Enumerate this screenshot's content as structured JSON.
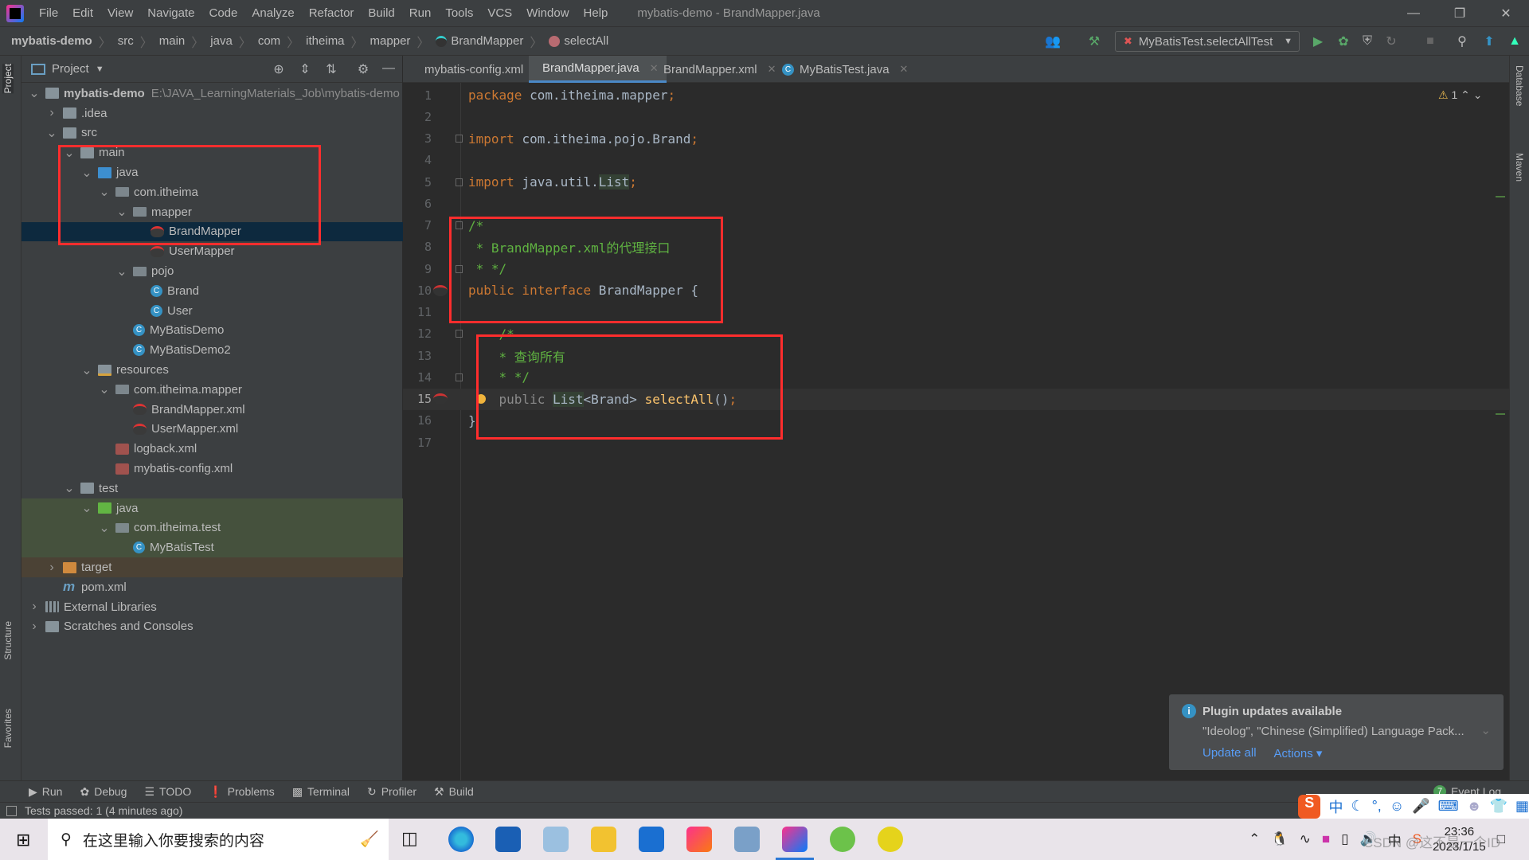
{
  "window": {
    "title": "mybatis-demo - BrandMapper.java",
    "controls": [
      "minimize",
      "restore",
      "close"
    ]
  },
  "menu": [
    "File",
    "Edit",
    "View",
    "Navigate",
    "Code",
    "Analyze",
    "Refactor",
    "Build",
    "Run",
    "Tools",
    "VCS",
    "Window",
    "Help"
  ],
  "breadcrumb": [
    "mybatis-demo",
    "src",
    "main",
    "java",
    "com",
    "itheima",
    "mapper",
    "BrandMapper",
    "selectAll"
  ],
  "toolbar": {
    "run_config": "MyBatisTest.selectAllTest"
  },
  "left_stripe": [
    "Project",
    "Structure",
    "Favorites"
  ],
  "right_stripe": [
    "Database",
    "Maven"
  ],
  "project": {
    "title": "Project",
    "root_path": "E:\\JAVA_LearningMaterials_Job\\mybatis-demo",
    "tree": [
      {
        "label": "mybatis-demo",
        "level": 0,
        "chev": "open",
        "icon": "module",
        "bold": true
      },
      {
        "label": ".idea",
        "level": 1,
        "chev": "closed",
        "icon": "folder"
      },
      {
        "label": "src",
        "level": 1,
        "chev": "open",
        "icon": "folder"
      },
      {
        "label": "main",
        "level": 2,
        "chev": "open",
        "icon": "folder"
      },
      {
        "label": "java",
        "level": 3,
        "chev": "open",
        "icon": "folder-blue"
      },
      {
        "label": "com.itheima",
        "level": 4,
        "chev": "open",
        "icon": "package"
      },
      {
        "label": "mapper",
        "level": 5,
        "chev": "open",
        "icon": "package"
      },
      {
        "label": "BrandMapper",
        "level": 6,
        "icon": "mapper",
        "selected": true
      },
      {
        "label": "UserMapper",
        "level": 6,
        "icon": "mapper"
      },
      {
        "label": "pojo",
        "level": 5,
        "chev": "open",
        "icon": "package"
      },
      {
        "label": "Brand",
        "level": 6,
        "icon": "class"
      },
      {
        "label": "User",
        "level": 6,
        "icon": "class"
      },
      {
        "label": "MyBatisDemo",
        "level": 5,
        "icon": "class"
      },
      {
        "label": "MyBatisDemo2",
        "level": 5,
        "icon": "class"
      },
      {
        "label": "resources",
        "level": 3,
        "chev": "open",
        "icon": "folder-res"
      },
      {
        "label": "com.itheima.mapper",
        "level": 4,
        "chev": "open",
        "icon": "package"
      },
      {
        "label": "BrandMapper.xml",
        "level": 5,
        "icon": "mapper-xml"
      },
      {
        "label": "UserMapper.xml",
        "level": 5,
        "icon": "mapper-xml"
      },
      {
        "label": "logback.xml",
        "level": 4,
        "icon": "xml"
      },
      {
        "label": "mybatis-config.xml",
        "level": 4,
        "icon": "xml"
      },
      {
        "label": "test",
        "level": 2,
        "chev": "open",
        "icon": "folder"
      },
      {
        "label": "java",
        "level": 3,
        "chev": "open",
        "icon": "folder-green",
        "test": true
      },
      {
        "label": "com.itheima.test",
        "level": 4,
        "chev": "open",
        "icon": "package",
        "test": true
      },
      {
        "label": "MyBatisTest",
        "level": 5,
        "icon": "class",
        "test": true
      },
      {
        "label": "target",
        "level": 1,
        "chev": "closed",
        "icon": "folder-orange",
        "excluded": true
      },
      {
        "label": "pom.xml",
        "level": 1,
        "icon": "maven"
      },
      {
        "label": "External Libraries",
        "level": 0,
        "chev": "closed",
        "icon": "libraries"
      },
      {
        "label": "Scratches and Consoles",
        "level": 0,
        "chev": "closed",
        "icon": "scratches"
      }
    ]
  },
  "tabs": [
    {
      "label": "mybatis-config.xml",
      "icon": "xml"
    },
    {
      "label": "BrandMapper.java",
      "icon": "mapper",
      "active": true
    },
    {
      "label": "BrandMapper.xml",
      "icon": "mapper-xml"
    },
    {
      "label": "MyBatisTest.java",
      "icon": "class"
    }
  ],
  "editor": {
    "warnings": "1",
    "current_line": 15,
    "lines": [
      [
        [
          "package ",
          "k"
        ],
        [
          "com.itheima.mapper",
          "i"
        ],
        [
          ";",
          "k"
        ]
      ],
      [],
      [
        [
          "import ",
          "k"
        ],
        [
          "com.itheima.pojo.Brand",
          "i"
        ],
        [
          ";",
          "k"
        ]
      ],
      [],
      [
        [
          "import ",
          "k"
        ],
        [
          "java.util.",
          "i"
        ],
        [
          "List",
          "i hl"
        ],
        [
          ";",
          "k"
        ]
      ],
      [],
      [
        [
          "/*",
          "cm"
        ]
      ],
      [
        [
          " * BrandMapper.xml的代理接口",
          "cm"
        ]
      ],
      [
        [
          " * */",
          "cm"
        ]
      ],
      [
        [
          "public interface ",
          "k"
        ],
        [
          "BrandMapper {",
          "i"
        ]
      ],
      [],
      [
        [
          "    /*",
          "cm"
        ]
      ],
      [
        [
          "    * 查询所有",
          "cm"
        ]
      ],
      [
        [
          "    * */",
          "cm"
        ]
      ],
      [
        [
          "    public ",
          "dim"
        ],
        [
          "List",
          "i hl"
        ],
        [
          "<Brand> ",
          "i"
        ],
        [
          "selectAll",
          "m"
        ],
        [
          "()",
          "i"
        ],
        [
          ";",
          "k"
        ]
      ],
      [
        [
          "}",
          "i"
        ]
      ],
      []
    ]
  },
  "notification": {
    "title": "Plugin updates available",
    "body": "\"Ideolog\", \"Chinese (Simplified) Language Pack...",
    "actions": [
      "Update all",
      "Actions ▾"
    ]
  },
  "tool_windows": [
    "Run",
    "Debug",
    "TODO",
    "Problems",
    "Terminal",
    "Profiler",
    "Build"
  ],
  "event_log": {
    "count": "7",
    "label": "Event Log"
  },
  "status": {
    "text": "Tests passed: 1 (4 minutes ago)"
  },
  "ime": {
    "mode": "中"
  },
  "taskbar": {
    "search_placeholder": "在这里输入你要搜索的内容",
    "tray_ime": "中",
    "time": "23:36",
    "date": "2023/1/15",
    "watermark": "CSDN @这不是一个ID"
  },
  "colors": {
    "accent": "#4a88c7",
    "highlight_box": "#ff2d2d",
    "selection": "#0d293e"
  }
}
